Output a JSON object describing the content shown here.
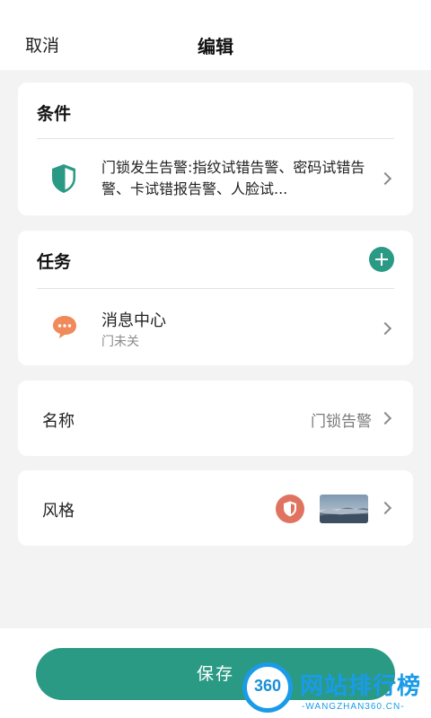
{
  "header": {
    "cancel_label": "取消",
    "title": "编辑"
  },
  "condition_card": {
    "heading": "条件",
    "icon": "shield-icon",
    "text": "门锁发生告警:指纹试错告警、密码试错告警、卡试错报告警、人脸试..."
  },
  "task_card": {
    "heading": "任务",
    "add_icon": "plus-icon",
    "item": {
      "icon": "chat-bubble-icon",
      "title": "消息中心",
      "subtitle": "门未关"
    }
  },
  "name_row": {
    "label": "名称",
    "value": "门锁告警"
  },
  "style_row": {
    "label": "风格",
    "icon": "shield-icon",
    "thumbnail": "landscape-thumbnail"
  },
  "save_label": "保存",
  "watermark": {
    "logo_number": "360",
    "name": "网站排行榜",
    "url": "-WANGZHAN360.CN-"
  },
  "colors": {
    "accent": "#2a9a84",
    "chat_icon": "#f08a5a",
    "style_shield": "#e07360",
    "watermark": "#1a9be8"
  }
}
